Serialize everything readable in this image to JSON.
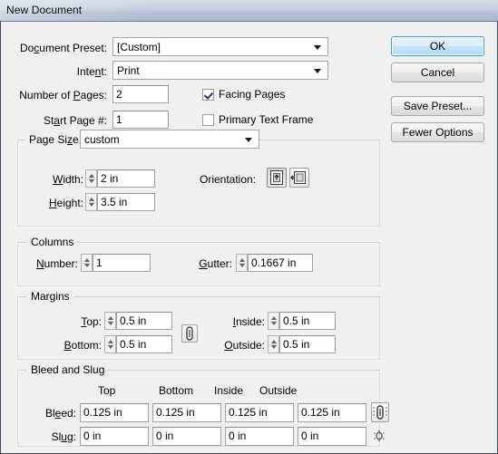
{
  "window": {
    "title": "New Document"
  },
  "buttons": {
    "ok": "OK",
    "cancel": "Cancel",
    "save_preset": "Save Preset...",
    "fewer_options": "Fewer Options"
  },
  "top": {
    "document_preset_label": "Document Preset:",
    "document_preset_value": "[Custom]",
    "intent_label": "Intent:",
    "intent_value": "Print",
    "number_of_pages_label": "Number of Pages:",
    "number_of_pages_value": "2",
    "start_page_label": "Start Page #:",
    "start_page_value": "1",
    "facing_pages_label": "Facing Pages",
    "facing_pages_checked": true,
    "primary_text_frame_label": "Primary Text Frame",
    "primary_text_frame_checked": false
  },
  "page_size": {
    "label": "Page Size:",
    "value": "custom",
    "width_label": "Width:",
    "width_value": "2 in",
    "height_label": "Height:",
    "height_value": "3.5 in",
    "orientation_label": "Orientation:",
    "orientation_portrait": "portrait-icon",
    "orientation_landscape": "landscape-icon"
  },
  "columns": {
    "title": "Columns",
    "number_label": "Number:",
    "number_value": "1",
    "gutter_label": "Gutter:",
    "gutter_value": "0.1667 in"
  },
  "margins": {
    "title": "Margins",
    "top_label": "Top:",
    "top_value": "0.5 in",
    "bottom_label": "Bottom:",
    "bottom_value": "0.5 in",
    "inside_label": "Inside:",
    "inside_value": "0.5 in",
    "outside_label": "Outside:",
    "outside_value": "0.5 in",
    "link_icon": "chain-link-icon"
  },
  "bleed_slug": {
    "title": "Bleed and Slug",
    "col_top": "Top",
    "col_bottom": "Bottom",
    "col_inside": "Inside",
    "col_outside": "Outside",
    "bleed_label": "Bleed:",
    "bleed_top": "0.125 in",
    "bleed_bottom": "0.125 in",
    "bleed_inside": "0.125 in",
    "bleed_outside": "0.125 in",
    "slug_label": "Slug:",
    "slug_top": "0 in",
    "slug_bottom": "0 in",
    "slug_inside": "0 in",
    "slug_outside": "0 in",
    "bleed_link_icon": "chain-link-icon",
    "slug_link_icon": "chain-link-broken-icon"
  },
  "colors": {
    "dialog_bg": "#f0f0f0",
    "title_bar": "#b2c1d4",
    "default_button_border": "#3c9fd4",
    "field_bg": "#ffffff"
  }
}
